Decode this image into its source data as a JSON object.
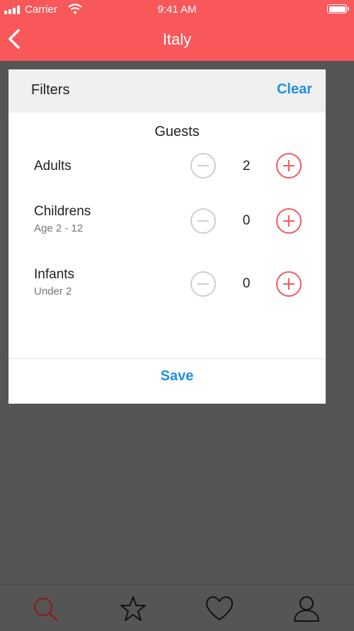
{
  "status_bar": {
    "carrier": "Carrier",
    "time": "9:41 AM"
  },
  "nav": {
    "title": "Italy",
    "back_icon": "chevron-left-icon"
  },
  "filter_panel": {
    "title": "Filters",
    "clear_label": "Clear",
    "section_title": "Guests",
    "rows": [
      {
        "label": "Adults",
        "sub": "",
        "count": "2"
      },
      {
        "label": "Childrens",
        "sub": "Age 2 - 12",
        "count": "0"
      },
      {
        "label": "Infants",
        "sub": "Under 2",
        "count": "0"
      }
    ],
    "save_label": "Save"
  },
  "tab_bar": {
    "tabs": [
      {
        "icon": "search-icon",
        "active": true
      },
      {
        "icon": "star-icon",
        "active": false
      },
      {
        "icon": "heart-icon",
        "active": false
      },
      {
        "icon": "profile-icon",
        "active": false
      }
    ]
  },
  "colors": {
    "header": "#f8585a",
    "accent_blue": "#1f8fe6",
    "stepper_red": "#f05a5e",
    "stepper_disabled": "#cfcfcf",
    "overlay": "#555555",
    "active_tab": "#8b1e1e"
  }
}
